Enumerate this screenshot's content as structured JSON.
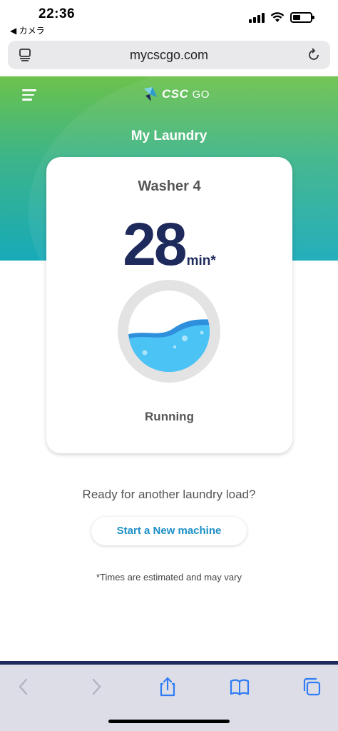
{
  "status_bar": {
    "time": "22:36",
    "back_app": "◀ カメラ",
    "battery_level": 0.45
  },
  "browser": {
    "url": "mycscgo.com"
  },
  "app": {
    "logo_text": "CSC",
    "logo_suffix": "GO",
    "page_title": "My Laundry"
  },
  "machine": {
    "name": "Washer 4",
    "minutes": "28",
    "unit": "min*",
    "status": "Running"
  },
  "prompt": "Ready for another laundry load?",
  "new_machine_button": "Start a New machine",
  "note": "*Times are estimated and may vary",
  "colors": {
    "gradient_top": "#6cc24b",
    "gradient_bottom": "#17aab8",
    "timer_text": "#1f2a5c",
    "button_text": "#1b8fc6",
    "water": "#4cc3f5"
  },
  "icons": [
    "tabs-icon",
    "reload-icon",
    "menu-icon",
    "back-icon",
    "forward-icon",
    "share-icon",
    "bookmarks-icon",
    "tab-overview-icon"
  ]
}
